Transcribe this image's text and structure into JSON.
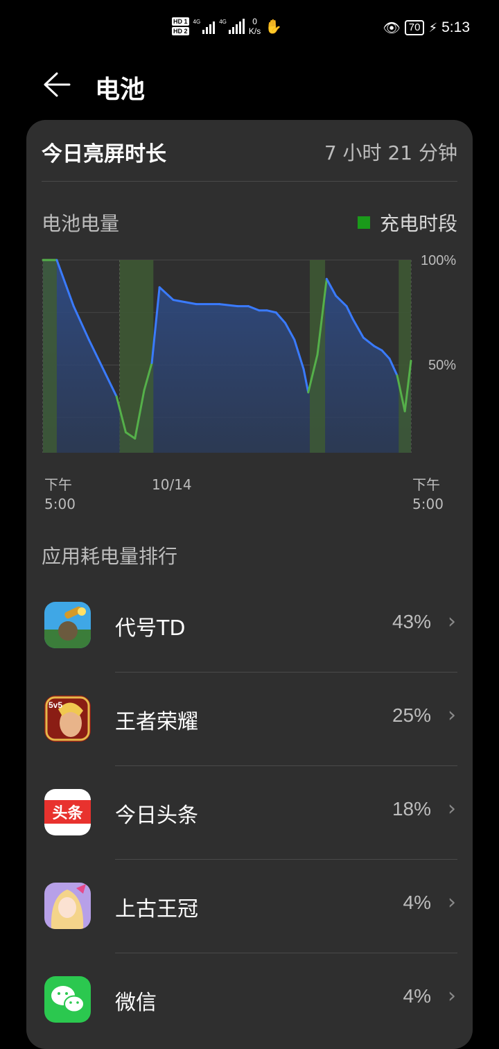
{
  "status_bar": {
    "hd1": "HD 1",
    "hd2": "HD 2",
    "sig1_label": "4G",
    "sig2_label": "4G",
    "speed_value": "0",
    "speed_unit": "K/s",
    "battery": "70",
    "time": "5:13",
    "icons": [
      "hd-icon",
      "signal-icon",
      "nfc-icon",
      "eye-icon",
      "battery-icon",
      "charging-icon"
    ]
  },
  "header": {
    "title": "电池",
    "back_icon": "arrow-left-icon"
  },
  "screen_time": {
    "label": "今日亮屏时长",
    "value": "7 小时 21 分钟"
  },
  "battery_chart": {
    "label": "电池电量",
    "legend_label": "充电时段",
    "legend_color": "#1a9a1a"
  },
  "chart_data": {
    "type": "line",
    "title": "电池电量",
    "y_tick_labels": [
      "100%",
      "50%"
    ],
    "ylim": [
      0,
      100
    ],
    "x_tick_labels": [
      {
        "top": "下午",
        "bottom": "5:00"
      },
      {
        "top": "10/14",
        "bottom": ""
      },
      {
        "top": "下午",
        "bottom": "5:00"
      }
    ],
    "x_range_hours": [
      0,
      24
    ],
    "series": [
      {
        "name": "",
        "color": "#3a7bff",
        "x": [
          0,
          0.9,
          2,
          3,
          4,
          4.8,
          5.4,
          6,
          6.6,
          7.1,
          7.6,
          8.5,
          10,
          11.5,
          12.7,
          13.4,
          14.1,
          14.6,
          15.2,
          15.8,
          16.4,
          17,
          17.3,
          17.9,
          18.5,
          19.1,
          19.8,
          20.2,
          20.9,
          21.6,
          22.1,
          22.6,
          23.1,
          23.6,
          24
        ],
        "y": [
          100,
          100,
          78,
          62,
          47,
          35,
          18,
          15,
          38,
          51,
          87,
          81,
          79,
          79,
          78,
          78,
          76,
          76,
          75,
          70,
          62,
          48,
          37,
          55,
          91,
          83,
          78,
          72,
          63,
          59,
          57,
          53,
          45,
          28,
          52
        ]
      }
    ],
    "charging_periods": [
      [
        0,
        0.9
      ],
      [
        5.0,
        7.2
      ],
      [
        17.4,
        18.4
      ],
      [
        23.2,
        24
      ]
    ],
    "grid": true
  },
  "app_ranking": {
    "title": "应用耗电量排行",
    "apps": [
      {
        "name": "代号TD",
        "percent": "43%",
        "icon": "game-cannon-icon"
      },
      {
        "name": "王者荣耀",
        "percent": "25%",
        "icon": "honor-of-kings-icon",
        "badge": "5v5"
      },
      {
        "name": "今日头条",
        "percent": "18%",
        "icon": "toutiao-icon",
        "badge": "头条"
      },
      {
        "name": "上古王冠",
        "percent": "4%",
        "icon": "anime-girl-icon"
      },
      {
        "name": "微信",
        "percent": "4%",
        "icon": "wechat-icon"
      }
    ],
    "chevron_icon": "chevron-right-icon"
  }
}
